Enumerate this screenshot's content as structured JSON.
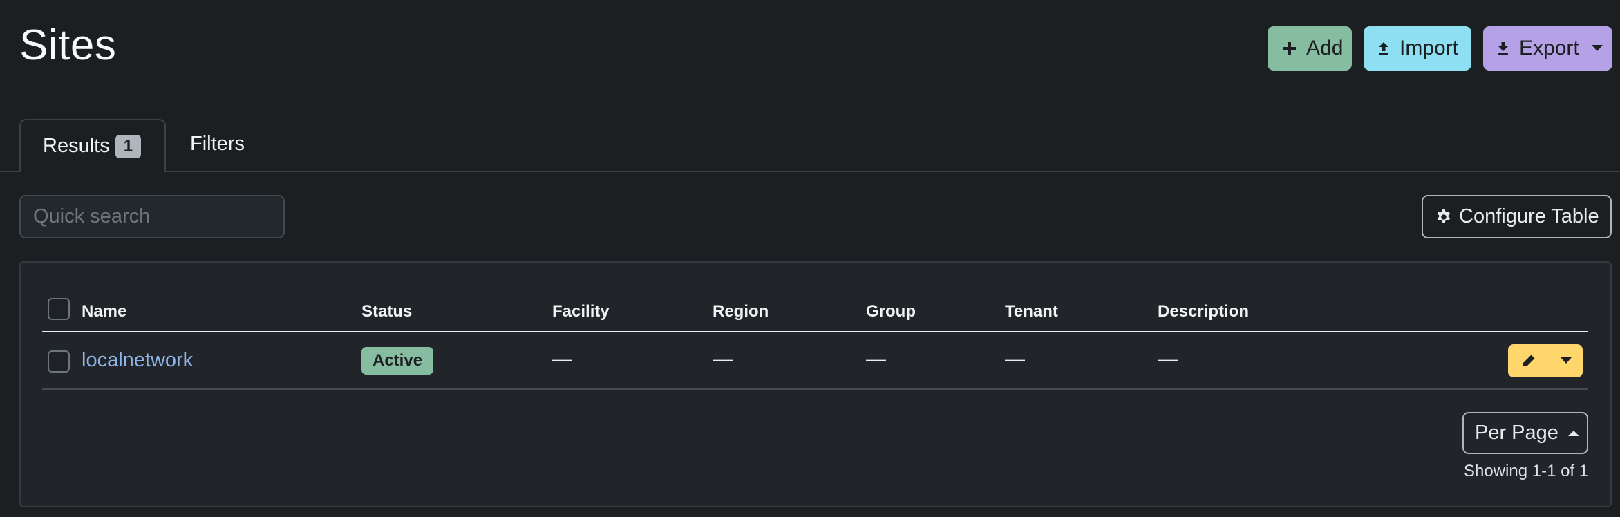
{
  "page": {
    "title": "Sites"
  },
  "header_actions": {
    "add_label": "Add",
    "import_label": "Import",
    "export_label": "Export"
  },
  "tabs": [
    {
      "label": "Results",
      "count": "1"
    },
    {
      "label": "Filters"
    }
  ],
  "search": {
    "placeholder": "Quick search",
    "value": ""
  },
  "configure_table": {
    "label": "Configure Table"
  },
  "table": {
    "columns": [
      "Name",
      "Status",
      "Facility",
      "Region",
      "Group",
      "Tenant",
      "Description"
    ],
    "rows": [
      {
        "name": "localnetwork",
        "status": "Active",
        "facility": "—",
        "region": "—",
        "group": "—",
        "tenant": "—",
        "description": "—"
      }
    ]
  },
  "pagination": {
    "per_page_label": "Per Page",
    "showing": "Showing 1-1 of 1"
  },
  "icons": {
    "add": "plus-icon",
    "import": "upload-icon",
    "export": "download-icon",
    "configure": "gear-icon",
    "edit": "pencil-icon",
    "row_menu": "chevron-down-icon"
  },
  "colors": {
    "background": "#1b1f22",
    "add": "#86bda0",
    "import": "#8fdff3",
    "export": "#b5a2e6",
    "status_active": "#86bda0",
    "edit": "#ffd66b",
    "link": "#8fb5e8"
  }
}
